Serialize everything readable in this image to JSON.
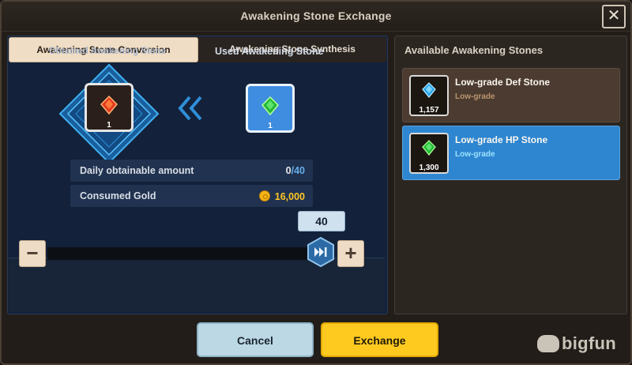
{
  "window": {
    "title": "Awakening Stone Exchange"
  },
  "tabs": [
    {
      "label": "Awakening Stone Conversion",
      "active": true
    },
    {
      "label": "Awakening Stone Synthesis",
      "active": false
    }
  ],
  "conversion": {
    "obtained_label": "Obtained Awakening Stone",
    "used_label": "Used Awakening Stone",
    "obtained_qty": "1",
    "used_qty": "1",
    "obtained_icon": "red-gem-icon",
    "used_icon": "green-gem-icon"
  },
  "info": {
    "daily_label": "Daily obtainable amount",
    "daily_current": "0",
    "daily_sep": "/",
    "daily_max": "40",
    "gold_label": "Consumed Gold",
    "gold_value": "16,000"
  },
  "slider": {
    "value": "40",
    "fraction": 1.0
  },
  "right_panel": {
    "title": "Available Awakening Stones",
    "items": [
      {
        "name": "Low-grade Def Stone",
        "grade": "Low-grade",
        "qty": "1,157",
        "icon": "blue-gem-icon",
        "selected": false
      },
      {
        "name": "Low-grade HP Stone",
        "grade": "Low-grade",
        "qty": "1,300",
        "icon": "green-gem-icon",
        "selected": true
      }
    ]
  },
  "buttons": {
    "cancel": "Cancel",
    "exchange": "Exchange"
  },
  "watermark": "bigfun",
  "colors": {
    "accent_gold": "#ffca1f",
    "selected_blue": "#2e86d0",
    "cancel_blue": "#bcd8e5"
  }
}
